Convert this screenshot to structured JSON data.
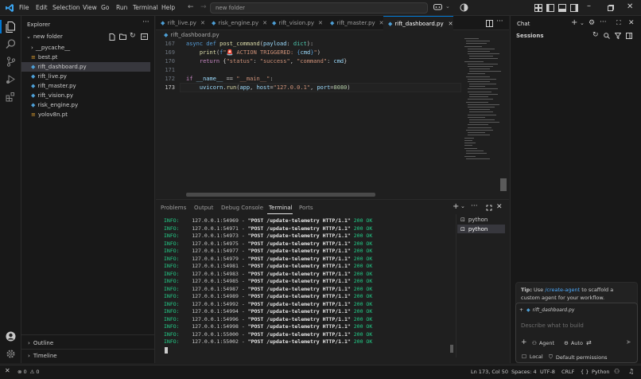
{
  "titlebar": {
    "menus": [
      "File",
      "Edit",
      "Selection",
      "View",
      "Go",
      "Run",
      "Terminal",
      "Help"
    ],
    "search": "new folder"
  },
  "explorer": {
    "title": "Explorer",
    "folder": "new folder",
    "items": [
      {
        "label": "__pycache__",
        "type": "folder"
      },
      {
        "label": "best.pt",
        "type": "file"
      },
      {
        "label": "rift_dashboard.py",
        "type": "py",
        "active": true
      },
      {
        "label": "rift_live.py",
        "type": "py"
      },
      {
        "label": "rift_master.py",
        "type": "py"
      },
      {
        "label": "rift_vision.py",
        "type": "py"
      },
      {
        "label": "risk_engine.py",
        "type": "py"
      },
      {
        "label": "yolov8n.pt",
        "type": "file"
      }
    ],
    "outline": "Outline",
    "timeline": "Timeline"
  },
  "editor": {
    "tabs": [
      "rift_live.py",
      "risk_engine.py",
      "rift_vision.py",
      "rift_master.py",
      "rift_dashboard.py"
    ],
    "breadcrumb": "rift_dashboard.py",
    "lines": [
      {
        "n": "167",
        "text": "async def post_command(payload: dict):"
      },
      {
        "n": "169",
        "text": "    print(f\"🚨 ACTION TRIGGERED: {cmd}\")"
      },
      {
        "n": "170",
        "text": "    return {\"status\": \"success\", \"command\": cmd}"
      },
      {
        "n": "171",
        "text": ""
      },
      {
        "n": "172",
        "text": "if __name__ == \"__main__\":"
      },
      {
        "n": "173",
        "text": "    uvicorn.run(app, host=\"127.0.0.1\", port=8080)"
      }
    ]
  },
  "panel": {
    "tabs": [
      "Problems",
      "Output",
      "Debug Console",
      "Terminal",
      "Ports"
    ],
    "active_tab": "Terminal",
    "terminals": [
      "python",
      "python"
    ],
    "log": [
      {
        "level": "INFO:",
        "addr": "127.0.0.1:54969",
        "req": "\"POST /update-telemetry HTTP/1.1\"",
        "status": "200 OK"
      },
      {
        "level": "INFO:",
        "addr": "127.0.0.1:54971",
        "req": "\"POST /update-telemetry HTTP/1.1\"",
        "status": "200 OK"
      },
      {
        "level": "INFO:",
        "addr": "127.0.0.1:54973",
        "req": "\"POST /update-telemetry HTTP/1.1\"",
        "status": "200 OK"
      },
      {
        "level": "INFO:",
        "addr": "127.0.0.1:54975",
        "req": "\"POST /update-telemetry HTTP/1.1\"",
        "status": "200 OK"
      },
      {
        "level": "INFO:",
        "addr": "127.0.0.1:54977",
        "req": "\"POST /update-telemetry HTTP/1.1\"",
        "status": "200 OK"
      },
      {
        "level": "INFO:",
        "addr": "127.0.0.1:54979",
        "req": "\"POST /update-telemetry HTTP/1.1\"",
        "status": "200 OK"
      },
      {
        "level": "INFO:",
        "addr": "127.0.0.1:54981",
        "req": "\"POST /update-telemetry HTTP/1.1\"",
        "status": "200 OK"
      },
      {
        "level": "INFO:",
        "addr": "127.0.0.1:54983",
        "req": "\"POST /update-telemetry HTTP/1.1\"",
        "status": "200 OK"
      },
      {
        "level": "INFO:",
        "addr": "127.0.0.1:54985",
        "req": "\"POST /update-telemetry HTTP/1.1\"",
        "status": "200 OK"
      },
      {
        "level": "INFO:",
        "addr": "127.0.0.1:54987",
        "req": "\"POST /update-telemetry HTTP/1.1\"",
        "status": "200 OK"
      },
      {
        "level": "INFO:",
        "addr": "127.0.0.1:54989",
        "req": "\"POST /update-telemetry HTTP/1.1\"",
        "status": "200 OK"
      },
      {
        "level": "INFO:",
        "addr": "127.0.0.1:54992",
        "req": "\"POST /update-telemetry HTTP/1.1\"",
        "status": "200 OK"
      },
      {
        "level": "INFO:",
        "addr": "127.0.0.1:54994",
        "req": "\"POST /update-telemetry HTTP/1.1\"",
        "status": "200 OK"
      },
      {
        "level": "INFO:",
        "addr": "127.0.0.1:54996",
        "req": "\"POST /update-telemetry HTTP/1.1\"",
        "status": "200 OK"
      },
      {
        "level": "INFO:",
        "addr": "127.0.0.1:54998",
        "req": "\"POST /update-telemetry HTTP/1.1\"",
        "status": "200 OK"
      },
      {
        "level": "INFO:",
        "addr": "127.0.0.1:55000",
        "req": "\"POST /update-telemetry HTTP/1.1\"",
        "status": "200 OK"
      },
      {
        "level": "INFO:",
        "addr": "127.0.0.1:55002",
        "req": "\"POST /update-telemetry HTTP/1.1\"",
        "status": "200 OK"
      }
    ]
  },
  "chat": {
    "title": "Chat",
    "sessions": "Sessions",
    "tip_prefix": "Tip:",
    "tip_mid": "Use",
    "tip_link": "/create-agent",
    "tip_rest": "to scaffold a custom agent for your workflow.",
    "context_file": "rift_dashboard.py",
    "input_placeholder": "Describe what to build",
    "agent_label": "Agent",
    "auto_label": "Auto",
    "local_label": "Local",
    "permissions_label": "Default permissions"
  },
  "statusbar": {
    "errors": "0",
    "warnings": "0",
    "position": "Ln 173, Col 50",
    "spaces": "Spaces: 4",
    "encoding": "UTF-8",
    "eol": "CRLF",
    "braces": "{ }",
    "language": "Python"
  },
  "colors": {
    "accent": "#0078d4",
    "string": "#ce9178",
    "keyword": "#569cd6",
    "control": "#c586c0",
    "function": "#dcdcaa",
    "number": "#b5cea8",
    "param": "#9cdcfe",
    "type": "#4ec9b0",
    "ok": "#23d18b"
  }
}
